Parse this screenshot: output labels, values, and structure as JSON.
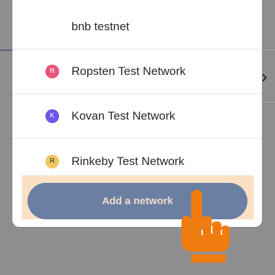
{
  "networks": [
    {
      "label": "bnb testnet",
      "initial": "",
      "color": ""
    },
    {
      "label": "Ropsten Test Network",
      "initial": "R",
      "color": "#e8567c"
    },
    {
      "label": "Kovan Test Network",
      "initial": "K",
      "color": "#6d55e6"
    },
    {
      "label": "Rinkeby Test Network",
      "initial": "R",
      "color": "#f0c862"
    }
  ],
  "add_network_label": "Add a network",
  "colors": {
    "accent_button": "#6b7fa3",
    "highlight": "#fbe0c6",
    "hand": "#f07c0f"
  },
  "icons": {
    "pointer": "hand-pointer-icon",
    "background_chevron": "chevron-right-icon"
  }
}
